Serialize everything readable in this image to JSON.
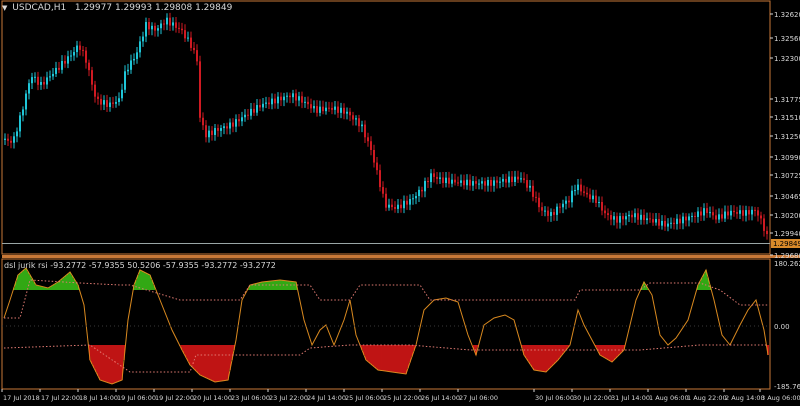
{
  "symbol": "USDCAD,H1",
  "ohlc": "1.29977 1.29993 1.29808 1.29849",
  "indicator_label": "dsl jurik rsi -93.2772 -57.9355 50.5206 -57.9355 -93.2772 -93.2772",
  "price_levels": [
    "1.32620",
    "1.32560",
    "1.32300",
    "1.31775",
    "1.31510",
    "1.31250",
    "1.30990",
    "1.30725",
    "1.30465",
    "1.30200",
    "1.29940",
    "1.29849",
    "1.29680"
  ],
  "current_price": "1.29849",
  "indicator_levels": [
    "180.2624",
    "0.00",
    "-185.7674"
  ],
  "time_labels": [
    "17 Jul 2018",
    "17 Jul 22:00",
    "18 Jul 14:00",
    "19 Jul 06:00",
    "19 Jul 22:00",
    "20 Jul 14:00",
    "23 Jul 06:00",
    "23 Jul 22:00",
    "24 Jul 14:00",
    "25 Jul 06:00",
    "25 Jul 22:00",
    "26 Jul 14:00",
    "27 Jul 06:00",
    "30 Jul 06:00",
    "30 Jul 22:00",
    "31 Jul 14:00",
    "1 Aug 06:00",
    "1 Aug 22:00",
    "2 Aug 14:00",
    "3 Aug 06:00",
    "3 Aug 14:00"
  ],
  "colors": {
    "background": "#000000",
    "frame": "#c87837",
    "bull": "#1fc6d8",
    "bear": "#d01a22",
    "axis_text": "#d8d8d8",
    "osc_line": "#d9891f",
    "osc_positive": "#43e01b",
    "osc_negative": "#ff1a1a",
    "signal_dots": "#e07a72",
    "current_price_bg": "#d98a2a",
    "current_price_line": "#9aa6a6"
  }
}
